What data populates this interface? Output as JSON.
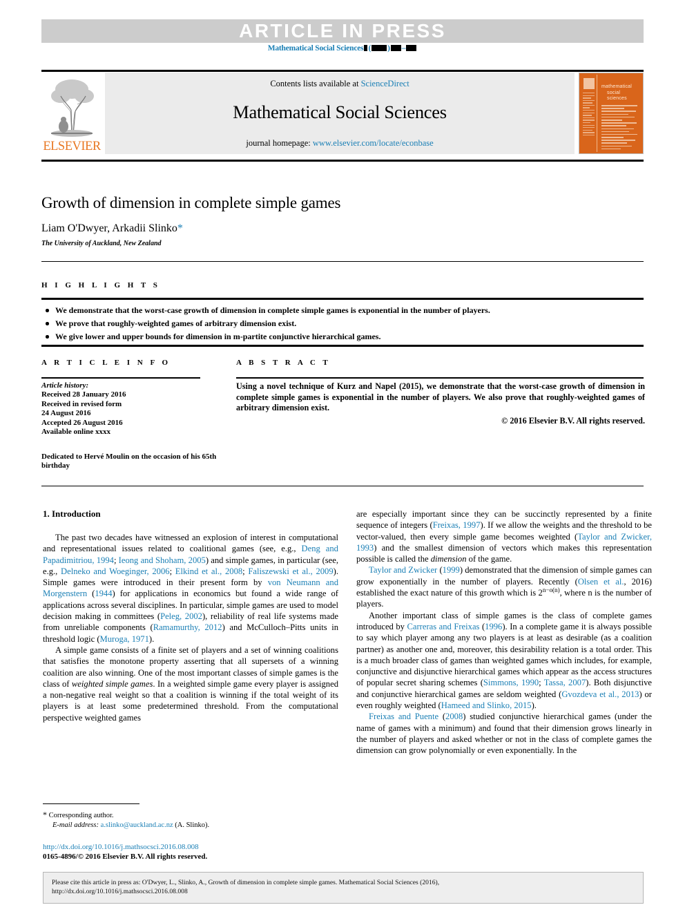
{
  "banner": {
    "text": "ARTICLE IN PRESS",
    "background": "#cccccc",
    "text_color": "#ffffff"
  },
  "running_head": {
    "journal": "Mathematical Social Sciences",
    "volume_placeholder": "▮",
    "year_placeholder": "(▮▮▮▮)",
    "pages_placeholder": "▮▮▮–▮▮▮",
    "color": "#1a7fb5"
  },
  "masthead": {
    "publisher": "ELSEVIER",
    "publisher_color": "#e87722",
    "contents_prefix": "Contents lists available at ",
    "contents_link": "ScienceDirect",
    "journal_title": "Mathematical Social Sciences",
    "homepage_prefix": "journal homepage: ",
    "homepage_link": "www.elsevier.com/locate/econbase",
    "link_color": "#1a7fb5",
    "cover": {
      "title_line1": "mathematical",
      "title_line2": "social",
      "title_line3": "sciences",
      "background": "#d9651b"
    }
  },
  "article": {
    "title": "Growth of dimension in complete simple games",
    "authors": "Liam O'Dwyer, Arkadii Slinko",
    "corresponding_marker": "*",
    "affiliation": "The University of Auckland, New Zealand"
  },
  "highlights": {
    "heading": "H I G H L I G H T S",
    "items": [
      "We demonstrate that the worst-case growth of dimension in complete simple games is exponential in the number of players.",
      "We prove that roughly-weighted games of arbitrary dimension exist.",
      "We give lower and upper bounds for dimension in m-partite conjunctive hierarchical games."
    ]
  },
  "article_info": {
    "heading": "A R T I C L E    I N F O",
    "history_label": "Article history:",
    "history": [
      "Received 28 January 2016",
      "Received in revised form",
      "24 August 2016",
      "Accepted 26 August 2016",
      "Available online xxxx"
    ],
    "dedication": "Dedicated to Hervé Moulin on the occasion of his 65th birthday"
  },
  "abstract": {
    "heading": "A B S T R A C T",
    "text": "Using a novel technique of Kurz and Napel (2015), we demonstrate that the worst-case growth of dimension in complete simple games is exponential in the number of players. We also prove that roughly-weighted games of arbitrary dimension exist.",
    "copyright": "© 2016 Elsevier B.V. All rights reserved."
  },
  "body": {
    "section_number": "1.",
    "section_title": "Introduction",
    "left_column": {
      "paragraph1": {
        "run1": "The past two decades have witnessed an explosion of interest in computational and representational issues related to coalitional games (see, e.g., ",
        "cite1": "Deng and Papadimitriou, 1994",
        "run2": "; ",
        "cite2": "Ieong and Shoham, 2005",
        "run3": ") and simple games, in particular (see, e.g., ",
        "cite3": "Delneko and Woeginger, 2006",
        "run4": "; ",
        "cite4": "Elkind et al., 2008",
        "run5": "; ",
        "cite5": "Faliszewski et al., 2009",
        "run6": "). Simple games were introduced in their present form by ",
        "cite6": "von Neumann and Morgenstern",
        "run7": " (",
        "cite7": "1944",
        "run8": ") for applications in economics but found a wide range of applications across several disciplines. In particular, simple games are used to model decision making in committees (",
        "cite8": "Peleg, 2002",
        "run9": "), reliability of real life systems made from unreliable components (",
        "cite9": "Ramamurthy, 2012",
        "run10": ") and McCulloch–Pitts units in threshold logic (",
        "cite10": "Muroga, 1971",
        "run11": ")."
      },
      "paragraph2": {
        "run1": "A simple game consists of a finite set of players and a set of winning coalitions that satisfies the monotone property asserting that all supersets of a winning coalition are also winning. One of the most important classes of simple games is the class of ",
        "italic1": "weighted simple games",
        "run2": ". In a weighted simple game every player is assigned a non-negative real weight so that a coalition is winning if the total weight of its players is at least some predetermined threshold. From the computational perspective weighted games"
      }
    },
    "right_column": {
      "paragraph1": {
        "run1": "are especially important since they can be succinctly represented by a finite sequence of integers (",
        "cite1": "Freixas, 1997",
        "run2": "). If we allow the weights and the threshold to be vector-valued, then every simple game becomes weighted (",
        "cite2": "Taylor and Zwicker, 1993",
        "run3": ") and the smallest dimension of vectors which makes this representation possible is called the ",
        "italic1": "dimension",
        "run4": " of the game."
      },
      "paragraph2": {
        "cite1": "Taylor and Zwicker",
        "run1": " (",
        "cite2": "1999",
        "run2": ") demonstrated that the dimension of simple games can grow exponentially in the number of players. Recently (",
        "cite3": "Olsen et al.",
        "run3": ", 2016) established the exact nature of this growth which is 2",
        "superscript": "n−o(n)",
        "run4": ", where n is the number of players."
      },
      "paragraph3": {
        "run1": "Another important class of simple games is the class of complete games introduced by ",
        "cite1": "Carreras and Freixas",
        "run2": " (",
        "cite2": "1996",
        "run3": "). In a complete game it is always possible to say which player among any two players is at least as desirable (as a coalition partner) as another one and, moreover, this desirability relation is a total order. This is a much broader class of games than weighted games which includes, for example, conjunctive and disjunctive hierarchical games which appear as the access structures of popular secret sharing schemes (",
        "cite3": "Simmons, 1990",
        "run4": "; ",
        "cite4": "Tassa, 2007",
        "run5": "). Both disjunctive and conjunctive hierarchical games are seldom weighted (",
        "cite5": "Gvozdeva et al., 2013",
        "run6": ") or even roughly weighted (",
        "cite6": "Hameed and Slinko, 2015",
        "run7": ")."
      },
      "paragraph4": {
        "cite1": "Freixas and Puente",
        "run1": " (",
        "cite2": "2008",
        "run2": ") studied conjunctive hierarchical games (under the name of games with a minimum) and found that their dimension grows linearly in the number of players and asked whether or not in the class of complete games the dimension can grow polynomially or even exponentially. In the"
      }
    }
  },
  "footnote": {
    "star": "*",
    "corresponding": "Corresponding author.",
    "email_label": "E-mail address:",
    "email": "a.slinko@auckland.ac.nz",
    "email_owner": "(A. Slinko)."
  },
  "doi_block": {
    "doi_url": "http://dx.doi.org/10.1016/j.mathsocsci.2016.08.008",
    "issn_line": "0165-4896/© 2016 Elsevier B.V. All rights reserved."
  },
  "cite_box": {
    "line1": "Please cite this article in press as: O'Dwyer, L., Slinko, A., Growth of dimension in complete simple games. Mathematical Social Sciences (2016),",
    "line2": "http://dx.doi.org/10.1016/j.mathsocsci.2016.08.008"
  }
}
